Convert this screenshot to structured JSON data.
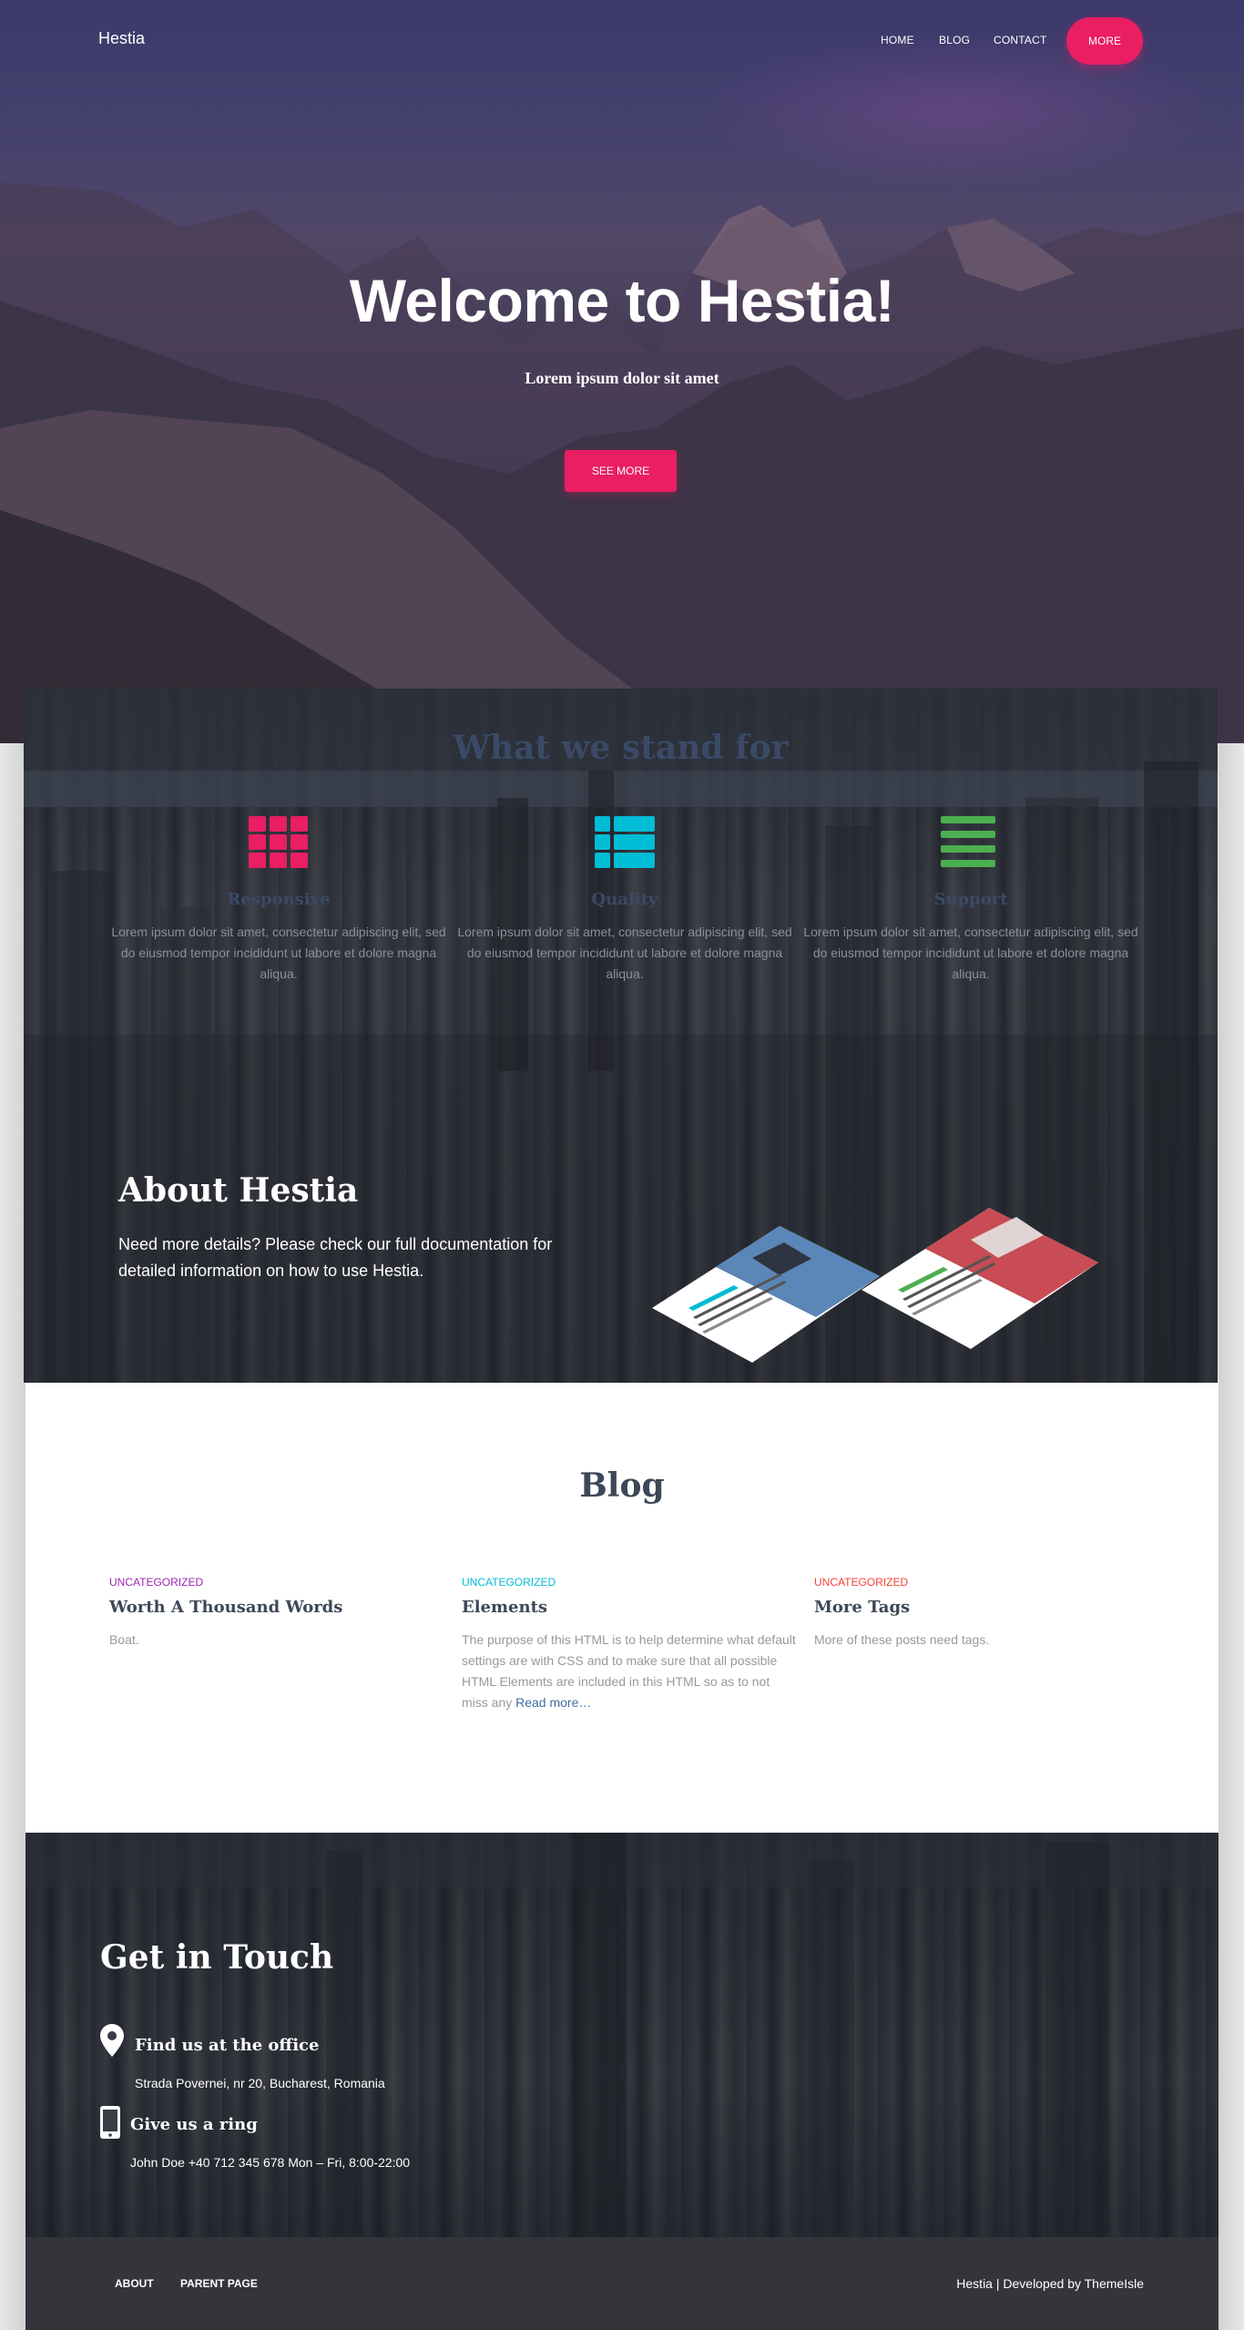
{
  "navbar": {
    "brand": "Hestia",
    "links": [
      "HOME",
      "BLOG",
      "CONTACT"
    ],
    "cta": "MORE"
  },
  "hero": {
    "title": "Welcome to Hestia!",
    "subtitle": "Lorem ipsum dolor sit amet",
    "button": "SEE MORE"
  },
  "features": {
    "title": "What we stand for",
    "items": [
      {
        "icon": "grid-icon",
        "title": "Responsive",
        "color": "#e91e63",
        "text": "Lorem ipsum dolor sit amet, consectetur adipiscing elit, sed do eiusmod tempor incididunt ut labore et dolore magna aliqua."
      },
      {
        "icon": "th-large-icon",
        "title": "Quality",
        "color": "#00bcd4",
        "text": "Lorem ipsum dolor sit amet, consectetur adipiscing elit, sed do eiusmod tempor incididunt ut labore et dolore magna aliqua."
      },
      {
        "icon": "list-icon",
        "title": "Support",
        "color": "#4caf50",
        "text": "Lorem ipsum dolor sit amet, consectetur adipiscing elit, sed do eiusmod tempor incididunt ut labore et dolore magna aliqua."
      }
    ]
  },
  "about": {
    "title": "About Hestia",
    "text": "Need more details? Please check our full documentation for detailed information on how to use Hestia."
  },
  "blog": {
    "title": "Blog",
    "posts": [
      {
        "category": "UNCATEGORIZED",
        "category_color": "#9c27b0",
        "title": "Worth A Thousand Words",
        "excerpt": "Boat.",
        "more": ""
      },
      {
        "category": "UNCATEGORIZED",
        "category_color": "#00bcd4",
        "title": "Elements",
        "excerpt": "The purpose of this HTML is to help determine what default settings are with CSS and to make sure that all possible HTML Elements are included in this HTML so as to not miss any",
        "more": "Read more…"
      },
      {
        "category": "UNCATEGORIZED",
        "category_color": "#f44336",
        "title": "More Tags",
        "excerpt": "More of these posts need tags.",
        "more": ""
      }
    ]
  },
  "contact": {
    "title": "Get in Touch",
    "office_heading": "Find us at the office",
    "office_text": "Strada Povernei, nr 20, Bucharest, Romania",
    "phone_heading": "Give us a ring",
    "phone_text": "John Doe +40 712 345 678 Mon – Fri, 8:00-22:00"
  },
  "footer": {
    "links": [
      "ABOUT",
      "PARENT PAGE"
    ],
    "copyright": "Hestia | Developed by ThemeIsle"
  }
}
